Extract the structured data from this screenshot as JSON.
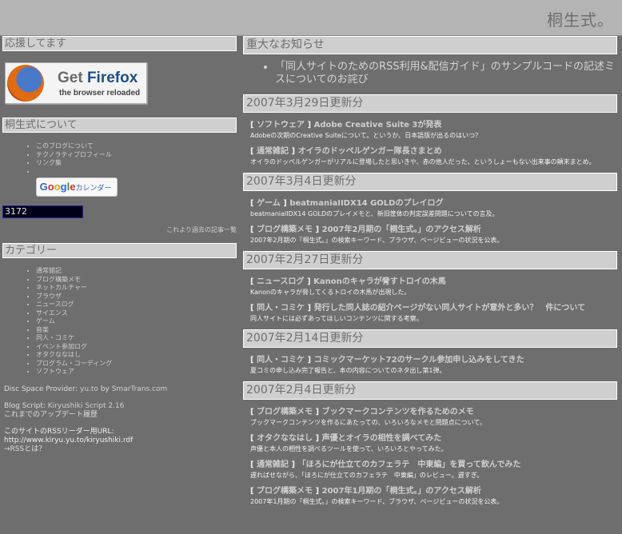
{
  "header": {
    "site_title": "桐生式。"
  },
  "sidebar": {
    "support_heading": "応援してます",
    "firefox": {
      "get": "Get ",
      "firefox": "Firefox",
      "sub": "the browser reloaded"
    },
    "about_heading": "桐生式について",
    "about_links": [
      "このブログについて",
      "テクノラティブロフィール",
      "リンク集"
    ],
    "gcal": {
      "g1": "G",
      "g2": "o",
      "g3": "o",
      "g4": "g",
      "g5": "l",
      "g6": "e",
      "jp": "カレンダー"
    },
    "counter": "3172",
    "older_link": "これより過去の記事一覧",
    "category_heading": "カテゴリー",
    "categories": [
      "通常雑記",
      "ブログ構築メモ",
      "ネットカルチャー",
      "ブラウザ",
      "ニュースログ",
      "サイエンス",
      "ゲーム",
      "音楽",
      "同人・コミケ",
      "イベント参加ログ",
      "オタクななはし",
      "プログラム・コーディング",
      "ソフトウェア"
    ],
    "disc_space_label": "Disc Space Provider: ",
    "disc_space_link": "yu.to",
    "disc_space_by": " by ",
    "disc_space_link2": "SmarTrans.com",
    "blog_script_label": "Blog Script: ",
    "blog_script_link": "Kiryushiki Script 2.16",
    "update_history": "これまでのアップデート履歴",
    "rss_label": "このサイトのRSSリーダー用URL:",
    "rss_url": "http://www.kiryu.yu.to/kiryushiki.rdf",
    "rss_what": "→RSSとは？"
  },
  "main": {
    "notice_heading": "重大なお知らせ",
    "notice_item": "「同人サイトのためのRSS利用&配信ガイド」のサンプルコードの記述ミスについてのお詫び",
    "sections": [
      {
        "date": "2007年3月29日更新分",
        "entries": [
          {
            "category": "ソフトウェア",
            "title": "Adobe Creative Suite 3が発表",
            "desc": "Adobeの次期のCreative Suiteについて。というか、日本語版が出るのはいつ？"
          },
          {
            "category": "通常雑記",
            "title": "オイラのドッペルゲンガー隊長さまとめ",
            "desc": "オイラのドッペルゲンガーがリアルに登場したと思いきや、赤の他人だった、というしょーもない出来事の顛末まとめ。"
          }
        ]
      },
      {
        "date": "2007年3月4日更新分",
        "entries": [
          {
            "category": "ゲーム",
            "title": "beatmaniaIIDX14 GOLDのプレイログ",
            "desc": "beatmaniaIIDX14 GOLDのプレイメモと、新旧筐体の判定誤差問題についての言及。"
          },
          {
            "category": "ブログ構築メモ",
            "title": "2007年2月期の「桐生式。」のアクセス解析",
            "desc": "2007年2月期の「桐生式。」の検索キーワード、ブラウザ、ページビューの状況を公表。"
          }
        ]
      },
      {
        "date": "2007年2月27日更新分",
        "entries": [
          {
            "category": "ニュースログ",
            "title": "Kanonのキャラが脅すトロイの木馬",
            "desc": "Kanonのキャラが脅してくるトロイの木馬が出現した。"
          },
          {
            "category": "同人・コミケ",
            "title": "発行した同人誌の紹介ページがない同人サイトが意外と多い？　件について",
            "desc": "同人サイトには必ずあってほしいコンテンツに関する考察。"
          }
        ]
      },
      {
        "date": "2007年2月14日更新分",
        "entries": [
          {
            "category": "同人・コミケ",
            "title": "コミックマーケット72のサークル参加申し込みをしてきた",
            "desc": "夏コミの申し込み完了報告と、本の内容についてのネタ出し第1弾。"
          }
        ]
      },
      {
        "date": "2007年2月4日更新分",
        "entries": [
          {
            "category": "ブログ構築メモ",
            "title": "ブックマークコンテンツを作るためのメモ",
            "desc": "ブックマークコンテンツを作るにあたっての、いろいろなメモと問題点について。"
          },
          {
            "category": "オタクななはし",
            "title": "声優とオイラの相性を調べてみた",
            "desc": "声優と本人の相性を調べるツールを使って、いろいろとやってみた。"
          },
          {
            "category": "通常雑記",
            "title": "「ほろにが仕立てのカフェラテ　中東編」を買って飲んでみた",
            "desc": "遅ればせながら、「ほろにが仕立てのカフェラテ　中東編」のレビュー。遅すぎ。"
          },
          {
            "category": "ブログ構築メモ",
            "title": "2007年1月期の「桐生式。」のアクセス解析",
            "desc": "2007年1月期の「桐生式。」の検索キーワード、ブラウザ、ページビューの状況を公表。"
          }
        ]
      }
    ]
  }
}
